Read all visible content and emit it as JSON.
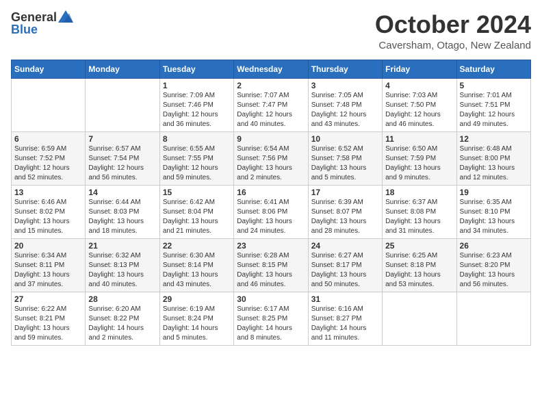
{
  "logo": {
    "general": "General",
    "blue": "Blue"
  },
  "header": {
    "month": "October 2024",
    "location": "Caversham, Otago, New Zealand"
  },
  "weekdays": [
    "Sunday",
    "Monday",
    "Tuesday",
    "Wednesday",
    "Thursday",
    "Friday",
    "Saturday"
  ],
  "weeks": [
    [
      {
        "day": "",
        "info": ""
      },
      {
        "day": "",
        "info": ""
      },
      {
        "day": "1",
        "info": "Sunrise: 7:09 AM\nSunset: 7:46 PM\nDaylight: 12 hours and 36 minutes."
      },
      {
        "day": "2",
        "info": "Sunrise: 7:07 AM\nSunset: 7:47 PM\nDaylight: 12 hours and 40 minutes."
      },
      {
        "day": "3",
        "info": "Sunrise: 7:05 AM\nSunset: 7:48 PM\nDaylight: 12 hours and 43 minutes."
      },
      {
        "day": "4",
        "info": "Sunrise: 7:03 AM\nSunset: 7:50 PM\nDaylight: 12 hours and 46 minutes."
      },
      {
        "day": "5",
        "info": "Sunrise: 7:01 AM\nSunset: 7:51 PM\nDaylight: 12 hours and 49 minutes."
      }
    ],
    [
      {
        "day": "6",
        "info": "Sunrise: 6:59 AM\nSunset: 7:52 PM\nDaylight: 12 hours and 52 minutes."
      },
      {
        "day": "7",
        "info": "Sunrise: 6:57 AM\nSunset: 7:54 PM\nDaylight: 12 hours and 56 minutes."
      },
      {
        "day": "8",
        "info": "Sunrise: 6:55 AM\nSunset: 7:55 PM\nDaylight: 12 hours and 59 minutes."
      },
      {
        "day": "9",
        "info": "Sunrise: 6:54 AM\nSunset: 7:56 PM\nDaylight: 13 hours and 2 minutes."
      },
      {
        "day": "10",
        "info": "Sunrise: 6:52 AM\nSunset: 7:58 PM\nDaylight: 13 hours and 5 minutes."
      },
      {
        "day": "11",
        "info": "Sunrise: 6:50 AM\nSunset: 7:59 PM\nDaylight: 13 hours and 9 minutes."
      },
      {
        "day": "12",
        "info": "Sunrise: 6:48 AM\nSunset: 8:00 PM\nDaylight: 13 hours and 12 minutes."
      }
    ],
    [
      {
        "day": "13",
        "info": "Sunrise: 6:46 AM\nSunset: 8:02 PM\nDaylight: 13 hours and 15 minutes."
      },
      {
        "day": "14",
        "info": "Sunrise: 6:44 AM\nSunset: 8:03 PM\nDaylight: 13 hours and 18 minutes."
      },
      {
        "day": "15",
        "info": "Sunrise: 6:42 AM\nSunset: 8:04 PM\nDaylight: 13 hours and 21 minutes."
      },
      {
        "day": "16",
        "info": "Sunrise: 6:41 AM\nSunset: 8:06 PM\nDaylight: 13 hours and 24 minutes."
      },
      {
        "day": "17",
        "info": "Sunrise: 6:39 AM\nSunset: 8:07 PM\nDaylight: 13 hours and 28 minutes."
      },
      {
        "day": "18",
        "info": "Sunrise: 6:37 AM\nSunset: 8:08 PM\nDaylight: 13 hours and 31 minutes."
      },
      {
        "day": "19",
        "info": "Sunrise: 6:35 AM\nSunset: 8:10 PM\nDaylight: 13 hours and 34 minutes."
      }
    ],
    [
      {
        "day": "20",
        "info": "Sunrise: 6:34 AM\nSunset: 8:11 PM\nDaylight: 13 hours and 37 minutes."
      },
      {
        "day": "21",
        "info": "Sunrise: 6:32 AM\nSunset: 8:13 PM\nDaylight: 13 hours and 40 minutes."
      },
      {
        "day": "22",
        "info": "Sunrise: 6:30 AM\nSunset: 8:14 PM\nDaylight: 13 hours and 43 minutes."
      },
      {
        "day": "23",
        "info": "Sunrise: 6:28 AM\nSunset: 8:15 PM\nDaylight: 13 hours and 46 minutes."
      },
      {
        "day": "24",
        "info": "Sunrise: 6:27 AM\nSunset: 8:17 PM\nDaylight: 13 hours and 50 minutes."
      },
      {
        "day": "25",
        "info": "Sunrise: 6:25 AM\nSunset: 8:18 PM\nDaylight: 13 hours and 53 minutes."
      },
      {
        "day": "26",
        "info": "Sunrise: 6:23 AM\nSunset: 8:20 PM\nDaylight: 13 hours and 56 minutes."
      }
    ],
    [
      {
        "day": "27",
        "info": "Sunrise: 6:22 AM\nSunset: 8:21 PM\nDaylight: 13 hours and 59 minutes."
      },
      {
        "day": "28",
        "info": "Sunrise: 6:20 AM\nSunset: 8:22 PM\nDaylight: 14 hours and 2 minutes."
      },
      {
        "day": "29",
        "info": "Sunrise: 6:19 AM\nSunset: 8:24 PM\nDaylight: 14 hours and 5 minutes."
      },
      {
        "day": "30",
        "info": "Sunrise: 6:17 AM\nSunset: 8:25 PM\nDaylight: 14 hours and 8 minutes."
      },
      {
        "day": "31",
        "info": "Sunrise: 6:16 AM\nSunset: 8:27 PM\nDaylight: 14 hours and 11 minutes."
      },
      {
        "day": "",
        "info": ""
      },
      {
        "day": "",
        "info": ""
      }
    ]
  ]
}
